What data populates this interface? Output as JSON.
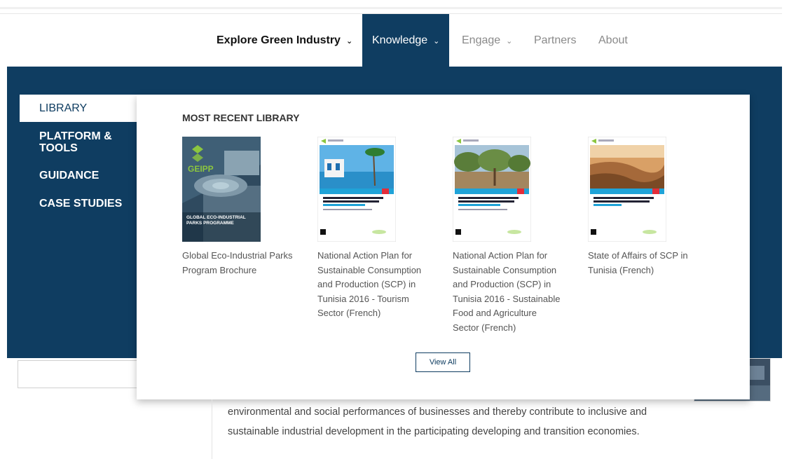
{
  "nav": {
    "items": [
      {
        "label": "Explore Green Industry",
        "chevron": true
      },
      {
        "label": "Knowledge",
        "chevron": true
      },
      {
        "label": "Engage",
        "chevron": true
      },
      {
        "label": "Partners",
        "chevron": false
      },
      {
        "label": "About",
        "chevron": false
      }
    ]
  },
  "side_menu": {
    "items": [
      {
        "label": "LIBRARY"
      },
      {
        "label": "PLATFORM & TOOLS"
      },
      {
        "label": "GUIDANCE"
      },
      {
        "label": "CASE STUDIES"
      }
    ]
  },
  "panel": {
    "title": "MOST RECENT LIBRARY",
    "cards": [
      {
        "title": "Global Eco-Industrial Parks Program Brochure",
        "cover_text_top": "GEIPP",
        "cover_text_bottom": "GLOBAL ECO-INDUSTRIAL PARKS PROGRAMME"
      },
      {
        "title": "National Action Plan for Sustainable Consumption and Production (SCP) in Tunisia 2016 - Tourism Sector (French)"
      },
      {
        "title": "National Action Plan for Sustainable Consumption and Production (SCP) in Tunisia 2016 - Sustainable Food and Agriculture Sector (French)"
      },
      {
        "title": "State of Affairs of SCP in Tunisia (French)"
      }
    ],
    "view_all_label": "View All"
  },
  "body": {
    "text_line1": "environmental and social performances of businesses and thereby contribute to inclusive and",
    "text_line2": "sustainable industrial development in the participating developing and transition economies."
  },
  "colors": {
    "navy": "#0f3d61",
    "accent_cyan": "#1fa3d8",
    "accent_red": "#e32d3a",
    "accent_green": "#8cc63f"
  }
}
